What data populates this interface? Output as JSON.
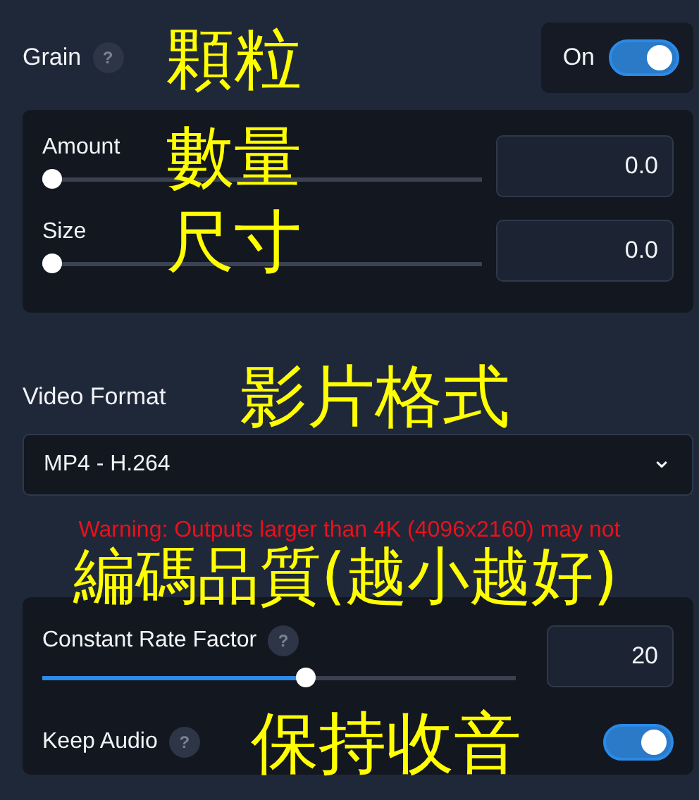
{
  "grain": {
    "label": "Grain",
    "help": "?",
    "toggle_label": "On",
    "on": true,
    "sliders": [
      {
        "label": "Amount",
        "level": 0,
        "value": "0.0"
      },
      {
        "label": "Size",
        "level": 0,
        "value": "0.0"
      }
    ]
  },
  "video_format": {
    "label": "Video Format",
    "select_value": "MP4  - H.264",
    "caret": "⌄"
  },
  "warning": "Warning: Outputs larger than 4K (4096x2160) may not",
  "encoding": {
    "slider": {
      "label": "Constant Rate Factor",
      "help": "?",
      "level": 0.56,
      "value": "20"
    },
    "keep_audio": {
      "label": "Keep Audio",
      "help": "?",
      "on": true
    }
  },
  "annotations": [
    "顆粒",
    "數量",
    "尺寸",
    "影片格式",
    "編碼品質(越小越好)",
    "保持收音"
  ]
}
